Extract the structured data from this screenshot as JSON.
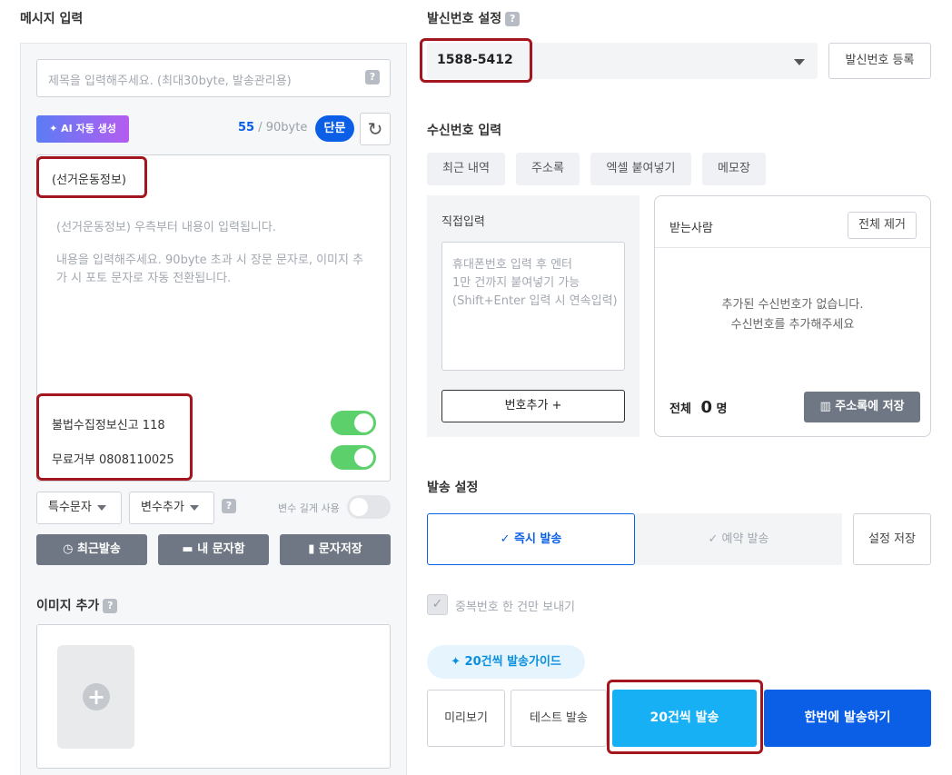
{
  "left": {
    "title": "메시지 입력",
    "subject_placeholder": "제목을 입력해주세요. (최대30byte, 발송관리용)",
    "help": "?",
    "ai_button": "AI 자동 생성",
    "byte_count": "55",
    "byte_limit": "/ 90byte",
    "msg_type_badge": "단문",
    "ad_prefix": "(선거운동정보)",
    "body_hint1": "(선거운동정보) 우측부터 내용이 입력됩니다.",
    "body_hint2": "내용을 입력해주세요. 90byte 초과 시 장문 문자로, 이미지 추가 시 포토 문자로 자동 전환됩니다.",
    "report_label": "불법수집정보신고 118",
    "optout_label": "무료거부 0808110025",
    "special_char": "특수문자",
    "variable_add": "변수추가",
    "variable_long": "변수 길게 사용",
    "recent_send": "최근발송",
    "my_box": "내 문자함",
    "save_msg": "문자저장",
    "image_title": "이미지 추가"
  },
  "sender": {
    "title": "발신번호 설정",
    "number": "1588-5412",
    "register_button": "발신번호 등록"
  },
  "recipient": {
    "title": "수신번호 입력",
    "tabs": [
      "최근 내역",
      "주소록",
      "엑셀 붙여넣기",
      "메모장"
    ],
    "direct_title": "직접입력",
    "direct_placeholder": "휴대폰번호 입력 후 엔터\n1만 건까지 붙여넣기 가능\n(Shift+Enter 입력 시 연속입력)",
    "add_number": "번호추가 +",
    "receivers_title": "받는사람",
    "clear_all": "전체 제거",
    "empty_line1": "추가된 수신번호가 없습니다.",
    "empty_line2": "수신번호를 추가해주세요",
    "total_label": "전체",
    "total_count": "0",
    "total_unit": "명",
    "save_to_contacts": "주소록에 저장"
  },
  "send_settings": {
    "title": "발송 설정",
    "instant": "즉시 발송",
    "reserved": "예약 발송",
    "save_settings": "설정 저장",
    "dedupe": "중복번호 한 건만 보내기",
    "guide_chip": "20건씩 발송가이드",
    "preview": "미리보기",
    "test_send": "테스트 발송",
    "send_20": "20건씩 발송",
    "send_all": "한번에 발송하기"
  },
  "colors": {
    "primary_blue": "#0a5fe6",
    "cyan": "#17b0f5",
    "highlight_red": "#a3161e",
    "toggle_green": "#5cd16b"
  }
}
